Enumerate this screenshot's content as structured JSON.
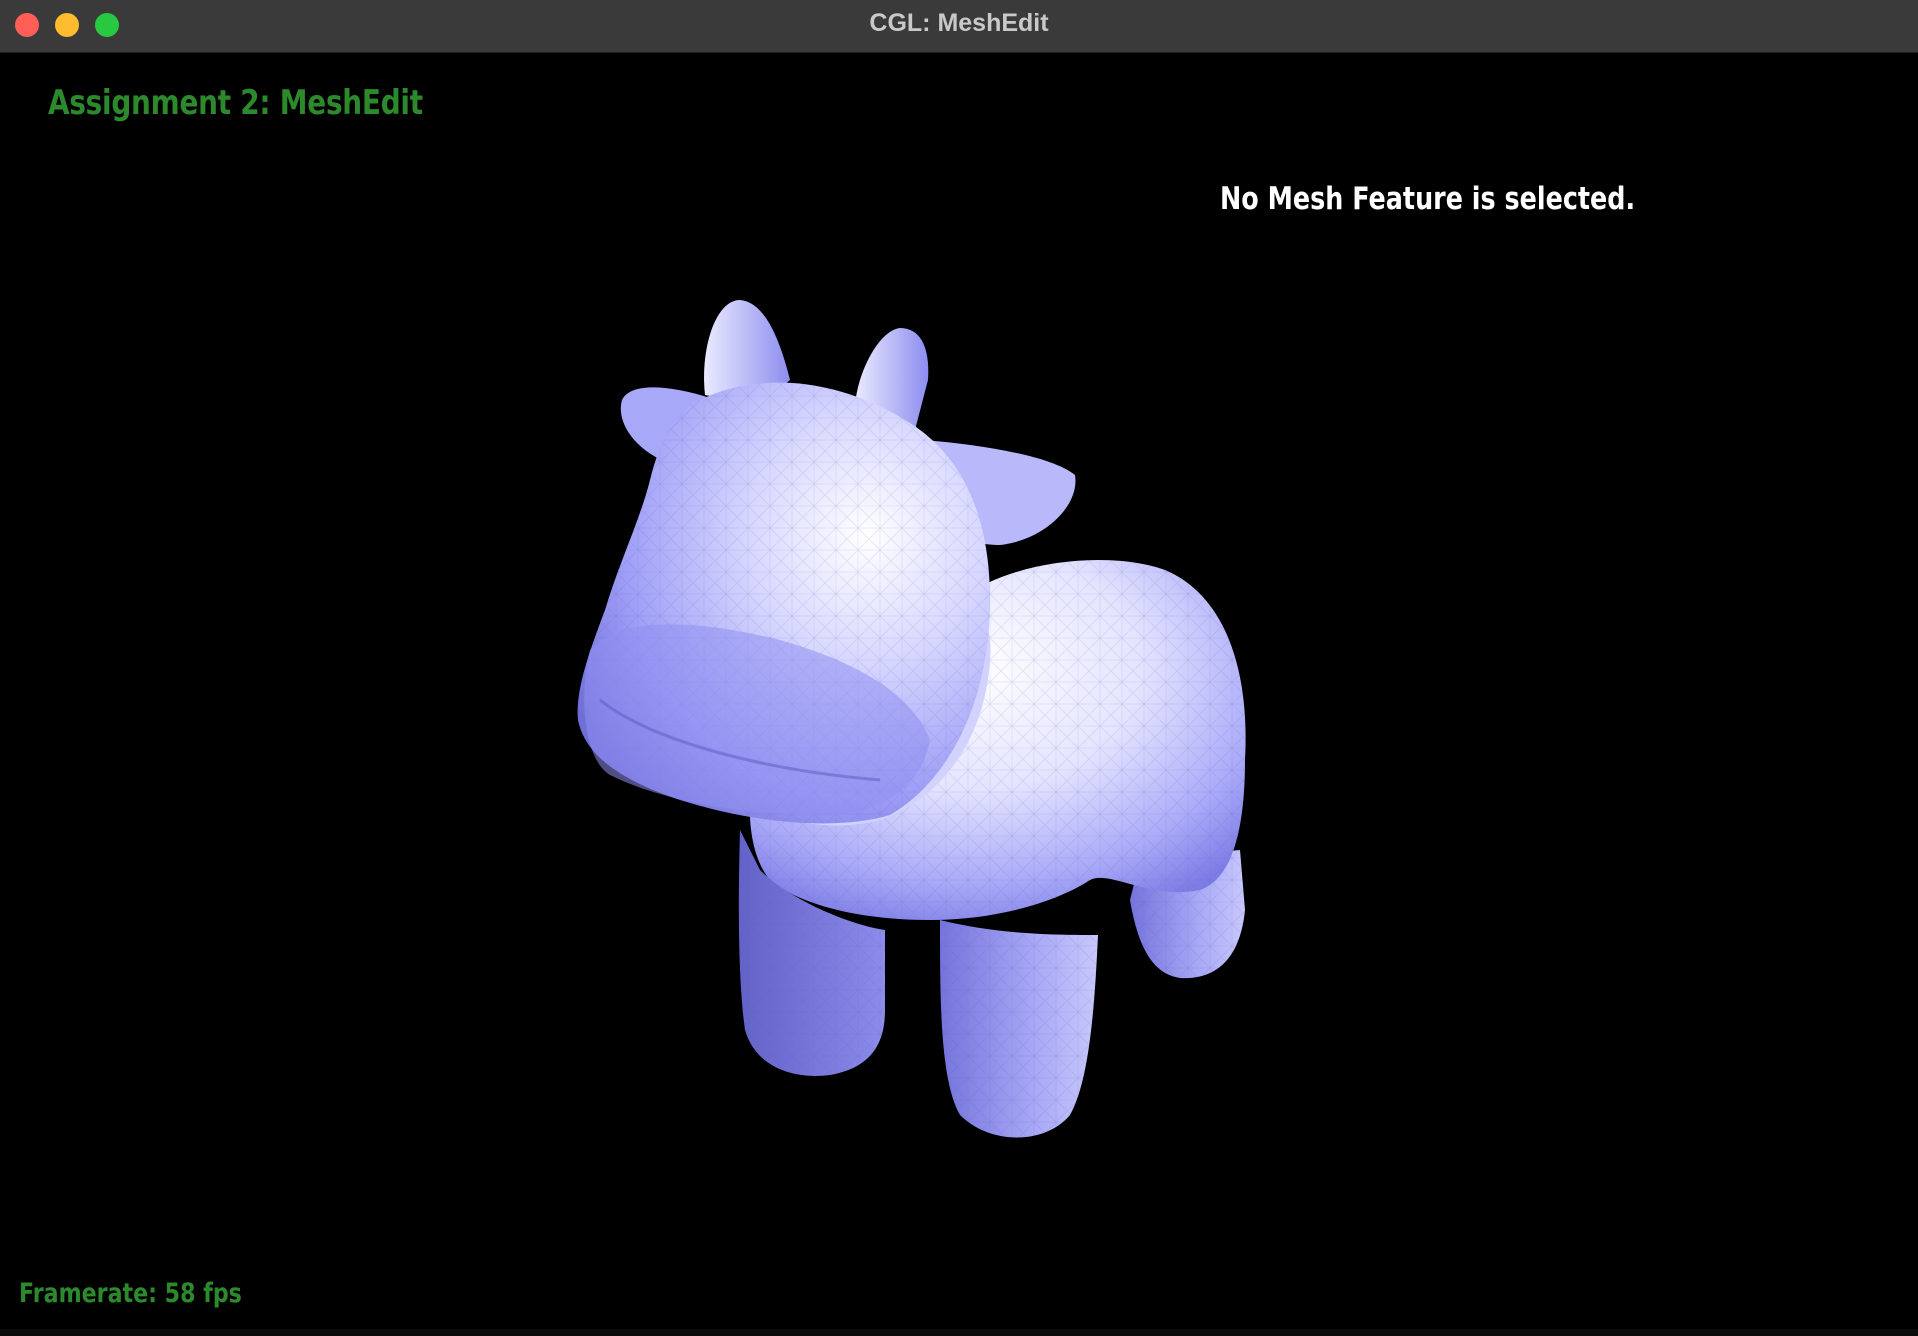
{
  "window": {
    "title": "CGL: MeshEdit"
  },
  "overlay": {
    "app_title": "Assignment 2: MeshEdit",
    "selection_status": "No Mesh Feature is selected.",
    "framerate": "Framerate: 58 fps"
  },
  "scene": {
    "model": "cow-mesh",
    "colors": {
      "background": "#000000",
      "mesh_base": "#8e8ef4",
      "mesh_highlight": "#ffffff",
      "overlay_green": "#2c8a2c"
    }
  }
}
